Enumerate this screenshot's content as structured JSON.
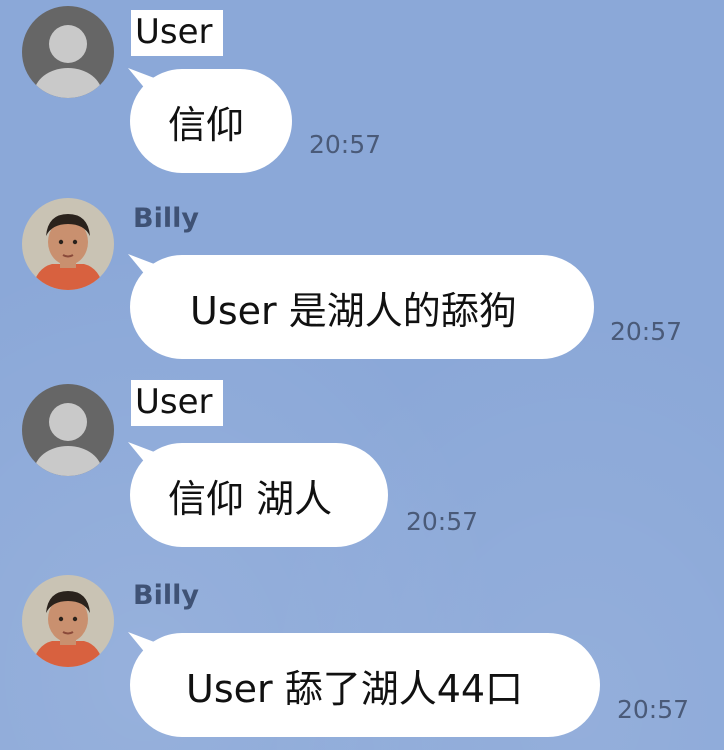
{
  "chat": {
    "messages": [
      {
        "sender": "User",
        "text": "信仰",
        "time": "20:57"
      },
      {
        "sender": "Billy",
        "text": "User  是湖人的舔狗",
        "time": "20:57"
      },
      {
        "sender": "User",
        "text": "信仰 湖人",
        "time": "20:57"
      },
      {
        "sender": "Billy",
        "text": "User   舔了湖人44口",
        "time": "20:57"
      }
    ]
  },
  "colors": {
    "background": "#8ba8d8",
    "bubble": "#ffffff",
    "billy_name": "#3f5275",
    "time": "#4a5a78"
  },
  "icons": {
    "default_avatar": "default-avatar-icon",
    "billy_avatar": "billy-avatar-photo"
  }
}
